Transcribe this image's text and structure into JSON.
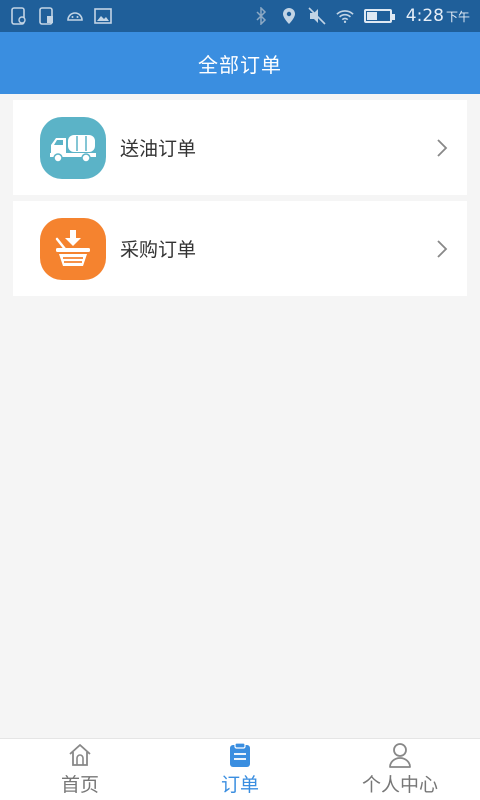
{
  "status_bar": {
    "time": "4:28",
    "ampm": "下午",
    "battery_level": 0.45,
    "icons": [
      "sim-icon",
      "sim-icon",
      "android-icon",
      "image-icon",
      "bluetooth-icon",
      "location-icon",
      "mute-icon",
      "wifi-icon",
      "battery-icon"
    ]
  },
  "header": {
    "title": "全部订单"
  },
  "orders": [
    {
      "label": "送油订单",
      "icon": "oil-truck-icon",
      "color": "#5bb3c7"
    },
    {
      "label": "采购订单",
      "icon": "shopping-basket-icon",
      "color": "#f5832f"
    }
  ],
  "bottom_nav": {
    "items": [
      {
        "label": "首页",
        "icon": "home-icon",
        "active": false
      },
      {
        "label": "订单",
        "icon": "clipboard-icon",
        "active": true
      },
      {
        "label": "个人中心",
        "icon": "user-icon",
        "active": false
      }
    ]
  },
  "colors": {
    "status_bar": "#1f5f9a",
    "header": "#3a8ee0",
    "accent": "#3a8ee0",
    "background": "#f5f5f5"
  }
}
